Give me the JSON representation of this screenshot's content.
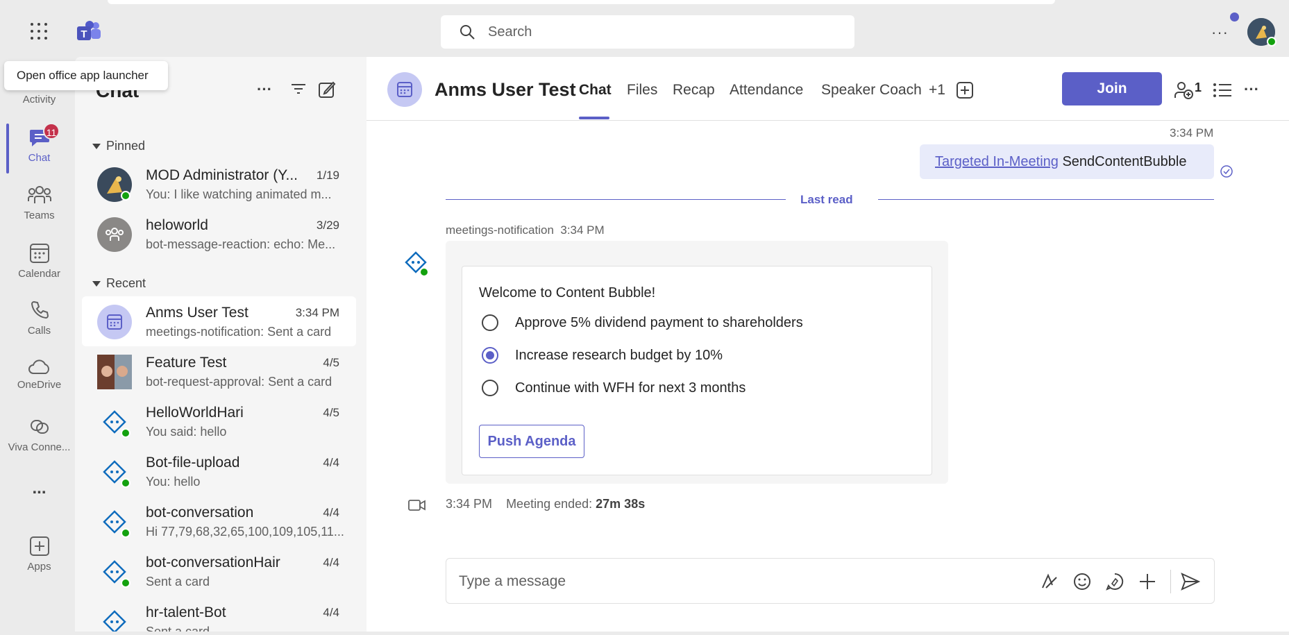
{
  "app": {
    "search_placeholder": "Search",
    "tooltip": "Open office app launcher",
    "top_more": "···"
  },
  "rail": {
    "items": [
      {
        "label": "Activity"
      },
      {
        "label": "Chat",
        "badge": "11"
      },
      {
        "label": "Teams"
      },
      {
        "label": "Calendar"
      },
      {
        "label": "Calls"
      },
      {
        "label": "OneDrive"
      },
      {
        "label": "Viva Conne..."
      },
      {
        "label": "..."
      },
      {
        "label": "Apps"
      }
    ]
  },
  "chatlist": {
    "title": "Chat",
    "pinned_label": "Pinned",
    "recent_label": "Recent",
    "pinned": [
      {
        "name": "MOD Administrator (Y...",
        "time": "1/19",
        "preview": "You: I like watching animated m..."
      },
      {
        "name": "heloworld",
        "time": "3/29",
        "preview": "bot-message-reaction: echo: Me..."
      }
    ],
    "recent": [
      {
        "name": "Anms User Test",
        "time": "3:34 PM",
        "preview": "meetings-notification: Sent a card"
      },
      {
        "name": "Feature Test",
        "time": "4/5",
        "preview": "bot-request-approval: Sent a card"
      },
      {
        "name": "HelloWorldHari",
        "time": "4/5",
        "preview": "You said: hello"
      },
      {
        "name": "Bot-file-upload",
        "time": "4/4",
        "preview": "You: hello"
      },
      {
        "name": "bot-conversation",
        "time": "4/4",
        "preview": "Hi 77,79,68,32,65,100,109,105,11..."
      },
      {
        "name": "bot-conversationHair",
        "time": "4/4",
        "preview": "Sent a card"
      },
      {
        "name": "hr-talent-Bot",
        "time": "4/4",
        "preview": "Sent a card"
      }
    ]
  },
  "header": {
    "title": "Anms User Test",
    "tabs": [
      "Chat",
      "Files",
      "Recap",
      "Attendance",
      "Speaker Coach",
      "+1"
    ],
    "join_label": "Join",
    "participants_count": "1"
  },
  "messages": {
    "my_time": "3:34 PM",
    "my_link": "Targeted In-Meeting",
    "my_text": " SendContentBubble",
    "last_read": "Last read",
    "sender": "meetings-notification",
    "sender_time": "3:34 PM",
    "card": {
      "title": "Welcome to Content Bubble!",
      "options": [
        {
          "label": "Approve 5% dividend payment to shareholders",
          "checked": false
        },
        {
          "label": "Increase research budget by 10%",
          "checked": true
        },
        {
          "label": "Continue with WFH for next 3 months",
          "checked": false
        }
      ],
      "button": "Push Agenda"
    },
    "ended_time": "3:34 PM",
    "ended_label": "Meeting ended: ",
    "ended_duration": "27m 38s"
  },
  "composer": {
    "placeholder": "Type a message"
  },
  "colors": {
    "accent": "#5b5fc7",
    "badge": "#c4314b",
    "presence": "#13a10e"
  }
}
